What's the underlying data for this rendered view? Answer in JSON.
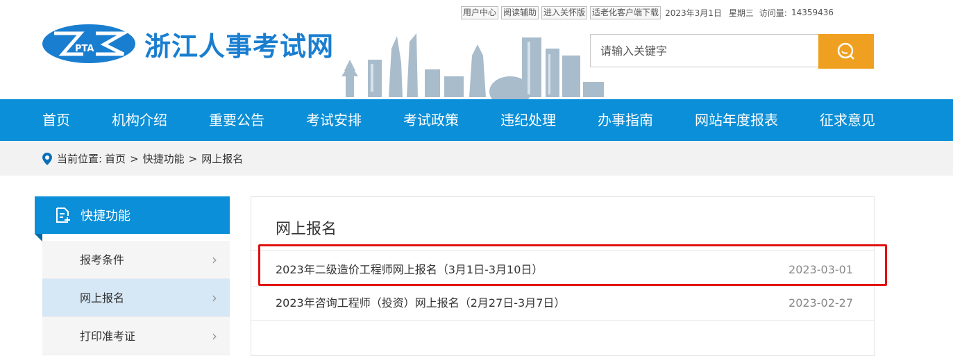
{
  "topbar": {
    "links": [
      "用户中心",
      "阅读辅助",
      "进入关怀版",
      "适老化客户端下载"
    ],
    "date": "2023年3月1日",
    "weekday": "星期三",
    "visits_label": "访问量:",
    "visits_value": "14359436"
  },
  "logo": {
    "badge_text": "PTA",
    "site_name": "浙江人事考试网"
  },
  "search": {
    "placeholder": "请输入关键字"
  },
  "nav": {
    "items": [
      "首页",
      "机构介绍",
      "重要公告",
      "考试安排",
      "考试政策",
      "违纪处理",
      "办事指南",
      "网站年度报表",
      "征求意见"
    ]
  },
  "breadcrumb": {
    "label": "当前位置:",
    "items": [
      "首页",
      "快捷功能",
      "网上报名"
    ],
    "separator": ">"
  },
  "sidebar": {
    "title": "快捷功能",
    "items": [
      "报考条件",
      "网上报名",
      "打印准考证"
    ],
    "active_index": 1
  },
  "content": {
    "title": "网上报名",
    "rows": [
      {
        "title": "2023年二级造价工程师网上报名（3月1日-3月10日）",
        "date": "2023-03-01"
      },
      {
        "title": "2023年咨询工程师（投资）网上报名（2月27日-3月7日）",
        "date": "2023-02-27"
      }
    ]
  },
  "colors": {
    "brand_blue": "#0b8fd8",
    "search_orange": "#f0a020",
    "highlight_red": "#e21010"
  }
}
